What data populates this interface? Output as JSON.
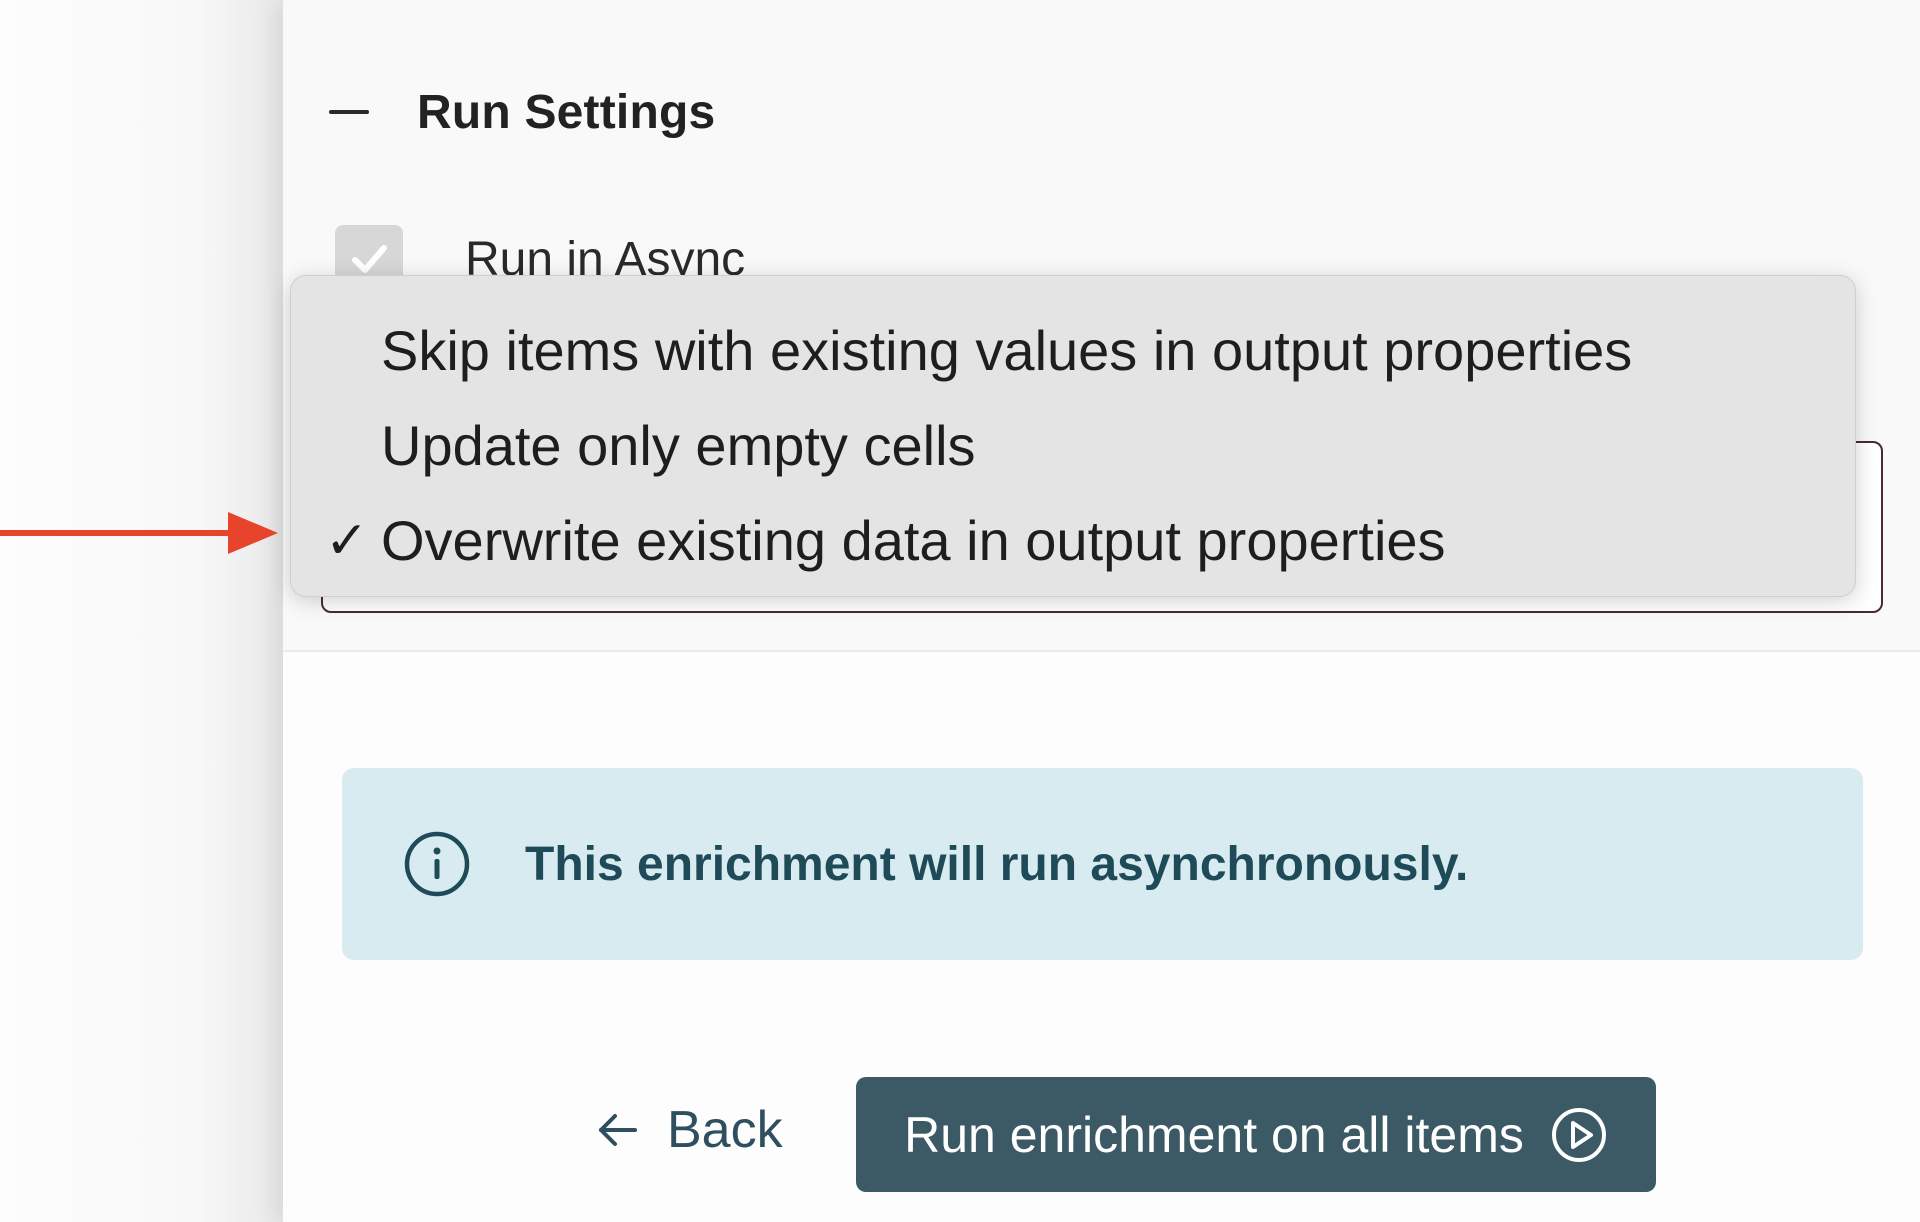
{
  "run_settings": {
    "title": "Run Settings",
    "run_in_async_label": "Run in Async",
    "run_in_async_checked": true
  },
  "dropdown": {
    "options": [
      "Skip items with existing values in output properties",
      "Update only empty cells",
      "Overwrite existing data in output properties"
    ],
    "selected_index": 2,
    "check_glyph": "✓"
  },
  "info_banner": {
    "icon": "info-circle-icon",
    "text": "This enrichment will run asynchronously."
  },
  "footer": {
    "back_label": "Back",
    "run_label": "Run enrichment on all items"
  },
  "colors": {
    "annotation_arrow": "#e8432b",
    "primary_button": "#3c5a66",
    "info_background": "#d8ebf0",
    "info_text": "#1f4b59"
  }
}
